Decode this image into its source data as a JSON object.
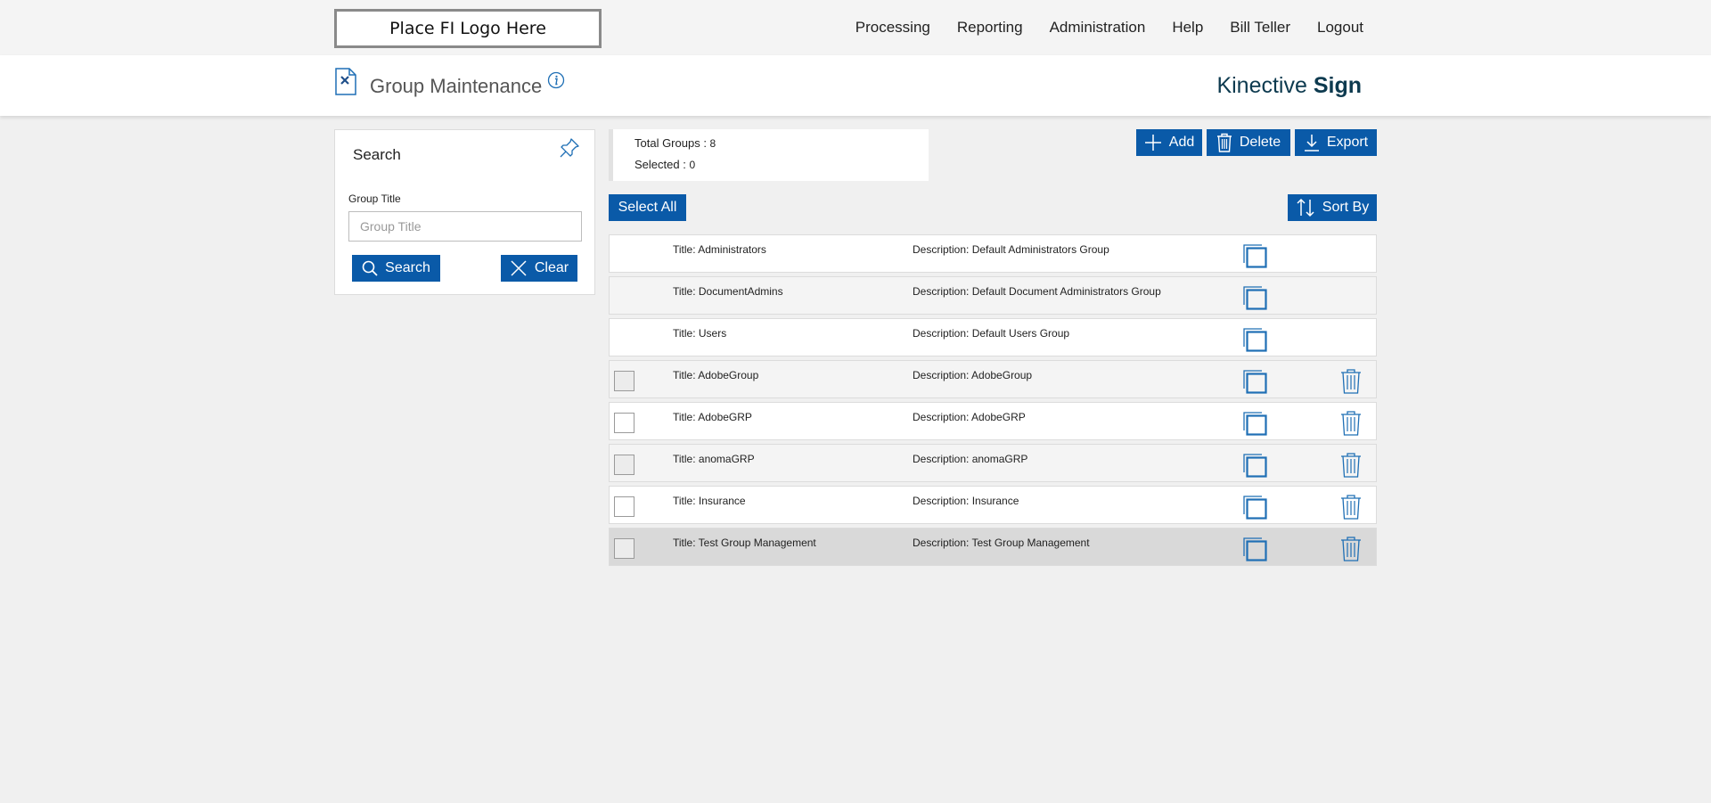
{
  "topbar": {
    "logo_text": "Place FI Logo Here",
    "nav": [
      "Processing",
      "Reporting",
      "Administration",
      "Help",
      "Bill Teller",
      "Logout"
    ]
  },
  "header": {
    "title": "Group Maintenance",
    "brand_light": "Kinective ",
    "brand_bold": "Sign"
  },
  "search": {
    "title": "Search",
    "field_label": "Group Title",
    "placeholder": "Group Title",
    "value": "",
    "search_label": "Search",
    "clear_label": "Clear"
  },
  "summary": {
    "total_label": "Total Groups : ",
    "total_value": "8",
    "selected_label": "Selected : ",
    "selected_value": "0"
  },
  "actions": {
    "add_label": "Add",
    "delete_label": "Delete",
    "export_label": "Export",
    "select_all_label": "Select All",
    "sort_by_label": "Sort By"
  },
  "colors": {
    "accent": "#0a5aa8",
    "icon_blue": "#1f6fb5",
    "brand": "#0d3a4f"
  },
  "groups": [
    {
      "title": "Title:  Administrators",
      "description": "Description: Default Administrators Group",
      "deletable": false
    },
    {
      "title": "Title:  DocumentAdmins",
      "description": "Description: Default Document Administrators Group",
      "deletable": false
    },
    {
      "title": "Title:  Users",
      "description": "Description: Default Users Group",
      "deletable": false
    },
    {
      "title": "Title:  AdobeGroup",
      "description": "Description: AdobeGroup",
      "deletable": true
    },
    {
      "title": "Title:  AdobeGRP",
      "description": "Description: AdobeGRP",
      "deletable": true
    },
    {
      "title": "Title:  anomaGRP",
      "description": "Description: anomaGRP",
      "deletable": true
    },
    {
      "title": "Title:  Insurance",
      "description": "Description: Insurance",
      "deletable": true
    },
    {
      "title": "Title:  Test Group Management",
      "description": "Description: Test Group Management",
      "deletable": true
    }
  ]
}
